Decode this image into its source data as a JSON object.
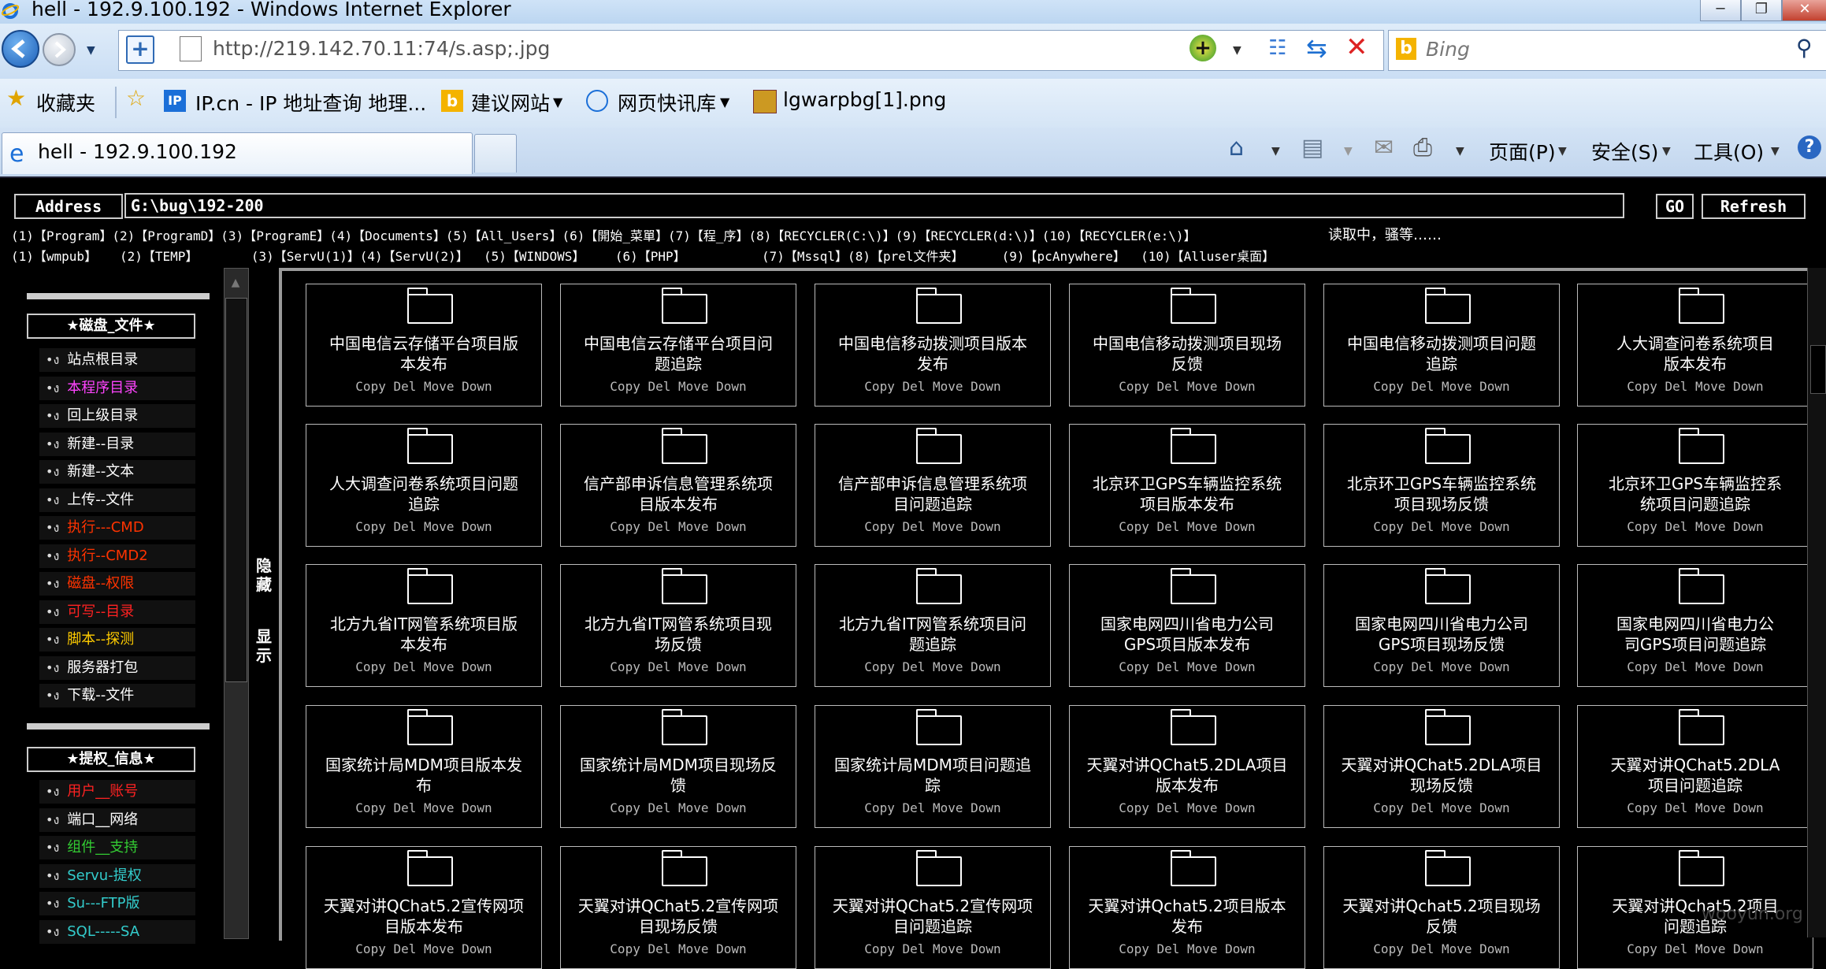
{
  "window": {
    "title": "hell - 192.9.100.192 - Windows Internet Explorer"
  },
  "addressbar": {
    "url": "http://219.142.70.11:74/s.asp;.jpg"
  },
  "search": {
    "placeholder": "Bing"
  },
  "favorites": {
    "label": "收藏夹",
    "items": [
      "IP.cn - IP 地址查询  地理...",
      "建议网站",
      "网页快讯库",
      "lgwarpbg[1].png"
    ]
  },
  "tab": {
    "label": "hell - 192.9.100.192"
  },
  "commandbar": {
    "page": "页面(P)",
    "safety": "安全(S)",
    "tools": "工具(O)"
  },
  "shell": {
    "address_label": "Address",
    "path": "G:\\bug\\192-200",
    "go": "GO",
    "refresh": "Refresh",
    "shortcuts_row1": "(1)【Program】(2)【ProgramD】(3)【ProgramE】(4)【Documents】(5)【All_Users】(6)【開始_菜單】(7)【程_序】(8)【RECYCLER(C:\\)】(9)【RECYCLER(d:\\)】(10)【RECYCLER(e:\\)】",
    "hint": "读取中，骚等……",
    "shortcuts_row2": "(1)【wmpub】   (2)【TEMP】       (3)【ServU(1)】(4)【ServU(2)】  (5)【WINDOWS】    (6)【PHP】          (7)【Mssql】(8)【prel文件夹】     (9)【pcAnywhere】  (10)【Alluser桌面】",
    "toggle_hide": "隐藏",
    "toggle_show": "显示"
  },
  "sidebar": {
    "disk_header": "★磁盘_文件★",
    "disk_items": [
      {
        "label": "站点根目录",
        "color": "#ffffff"
      },
      {
        "label": "本程序目录",
        "color": "#ff44ff"
      },
      {
        "label": "回上级目录",
        "color": "#ffffff"
      },
      {
        "label": "新建--目录",
        "color": "#ffffff"
      },
      {
        "label": "新建--文本",
        "color": "#ffffff"
      },
      {
        "label": "上传--文件",
        "color": "#ffffff"
      },
      {
        "label": "执行---CMD",
        "color": "#ff3300"
      },
      {
        "label": "执行--CMD2",
        "color": "#ff3300"
      },
      {
        "label": "磁盘--权限",
        "color": "#ff3300"
      },
      {
        "label": "可写--目录",
        "color": "#ff2222"
      },
      {
        "label": "脚本--探测",
        "color": "#ffcc00"
      },
      {
        "label": "服务器打包",
        "color": "#ffffff"
      },
      {
        "label": "下载--文件",
        "color": "#ffffff"
      }
    ],
    "priv_header": "★提权_信息★",
    "priv_items": [
      {
        "label": "用户__账号",
        "color": "#ff2222"
      },
      {
        "label": "端口__网络",
        "color": "#ffffff"
      },
      {
        "label": "组件__支持",
        "color": "#33cc33"
      },
      {
        "label": "Servu-提权",
        "color": "#33cccc"
      },
      {
        "label": "Su---FTP版",
        "color": "#33cccc"
      },
      {
        "label": "SQL-----SA",
        "color": "#33cccc"
      }
    ]
  },
  "folders": {
    "actions": "Copy Del Move Down",
    "items": [
      [
        "中国电信云存储平台项目版",
        "本发布"
      ],
      [
        "中国电信云存储平台项目问",
        "题追踪"
      ],
      [
        "中国电信移动拨测项目版本",
        "发布"
      ],
      [
        "中国电信移动拨测项目现场",
        "反馈"
      ],
      [
        "中国电信移动拨测项目问题",
        "追踪"
      ],
      [
        "人大调查问卷系统项目",
        "版本发布"
      ],
      [
        "人大调查问卷系统项目问题",
        "追踪"
      ],
      [
        "信产部申诉信息管理系统项",
        "目版本发布"
      ],
      [
        "信产部申诉信息管理系统项",
        "目问题追踪"
      ],
      [
        "北京环卫GPS车辆监控系统",
        "项目版本发布"
      ],
      [
        "北京环卫GPS车辆监控系统",
        "项目现场反馈"
      ],
      [
        "北京环卫GPS车辆监控系",
        "统项目问题追踪"
      ],
      [
        "北方九省IT网管系统项目版",
        "本发布"
      ],
      [
        "北方九省IT网管系统项目现",
        "场反馈"
      ],
      [
        "北方九省IT网管系统项目问",
        "题追踪"
      ],
      [
        "国家电网四川省电力公司",
        "GPS项目版本发布"
      ],
      [
        "国家电网四川省电力公司",
        "GPS项目现场反馈"
      ],
      [
        "国家电网四川省电力公",
        "司GPS项目问题追踪"
      ],
      [
        "国家统计局MDM项目版本发",
        "布"
      ],
      [
        "国家统计局MDM项目现场反",
        "馈"
      ],
      [
        "国家统计局MDM项目问题追",
        "踪"
      ],
      [
        "天翼对讲QChat5.2DLA项目",
        "版本发布"
      ],
      [
        "天翼对讲QChat5.2DLA项目",
        "现场反馈"
      ],
      [
        "天翼对讲QChat5.2DLA",
        "项目问题追踪"
      ],
      [
        "天翼对讲QChat5.2宣传网项",
        "目版本发布"
      ],
      [
        "天翼对讲QChat5.2宣传网项",
        "目现场反馈"
      ],
      [
        "天翼对讲QChat5.2宣传网项",
        "目问题追踪"
      ],
      [
        "天翼对讲Qchat5.2项目版本",
        "发布"
      ],
      [
        "天翼对讲Qchat5.2项目现场",
        "反馈"
      ],
      [
        "天翼对讲Qchat5.2项目",
        "问题追踪"
      ]
    ]
  },
  "watermark": "wooyun.org"
}
